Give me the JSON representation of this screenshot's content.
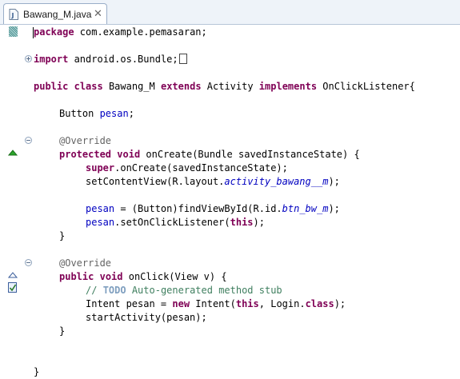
{
  "tab": {
    "title": "Bawang_M.java",
    "close": "✕"
  },
  "code": {
    "l1": {
      "kw": "package",
      "rest": " com.example.pemasaran;"
    },
    "l2": {
      "kw": "import",
      "rest": " android.os.Bundle;"
    },
    "l3": {
      "kw1": "public",
      "kw2": "class",
      "name": " Bawang_M ",
      "kw3": "extends",
      "mid": " Activity ",
      "kw4": "implements",
      "tail": " OnClickListener{"
    },
    "l4": {
      "type": "Button ",
      "field": "pesan",
      "tail": ";"
    },
    "l5": {
      "anno": "@Override"
    },
    "l6": {
      "kw1": "protected",
      "kw2": "void",
      "tail": " onCreate(Bundle savedInstanceState) {"
    },
    "l7": {
      "kw": "super",
      "tail": ".onCreate(savedInstanceState);"
    },
    "l8": {
      "head": "setContentView(R.layout.",
      "ital": "activity_bawang__m",
      "tail": ");"
    },
    "l9": {
      "field": "pesan",
      "mid": " = (Button)findViewById(R.id.",
      "ital": "btn_bw_m",
      "tail": ");"
    },
    "l10": {
      "field": "pesan",
      "mid": ".setOnClickListener(",
      "kw": "this",
      "tail": ");"
    },
    "l11": {
      "text": "}"
    },
    "l12": {
      "anno": "@Override"
    },
    "l13": {
      "kw1": "public",
      "kw2": "void",
      "tail": " onClick(View v) {"
    },
    "l14": {
      "cmt": "// ",
      "todo": "TODO",
      "rest": " Auto-generated method stub"
    },
    "l15": {
      "head": "Intent pesan = ",
      "kw1": "new",
      "mid": " Intent(",
      "kw2": "this",
      "mid2": ", Login.",
      "kw3": "class",
      "tail": ");"
    },
    "l16": {
      "text": "startActivity(pesan);"
    },
    "l17": {
      "text": "}"
    },
    "l18": {
      "text": "}"
    }
  },
  "colors": {
    "keyword": "#7f0055",
    "field": "#0000c0",
    "annotation": "#646464",
    "comment": "#3f7f5f",
    "todo": "#7f9fbf"
  },
  "icons": [
    "java-file-icon",
    "close-icon",
    "fold-icon",
    "override-triangle-icon",
    "implements-triangle-icon",
    "task-checkbox-icon"
  ]
}
